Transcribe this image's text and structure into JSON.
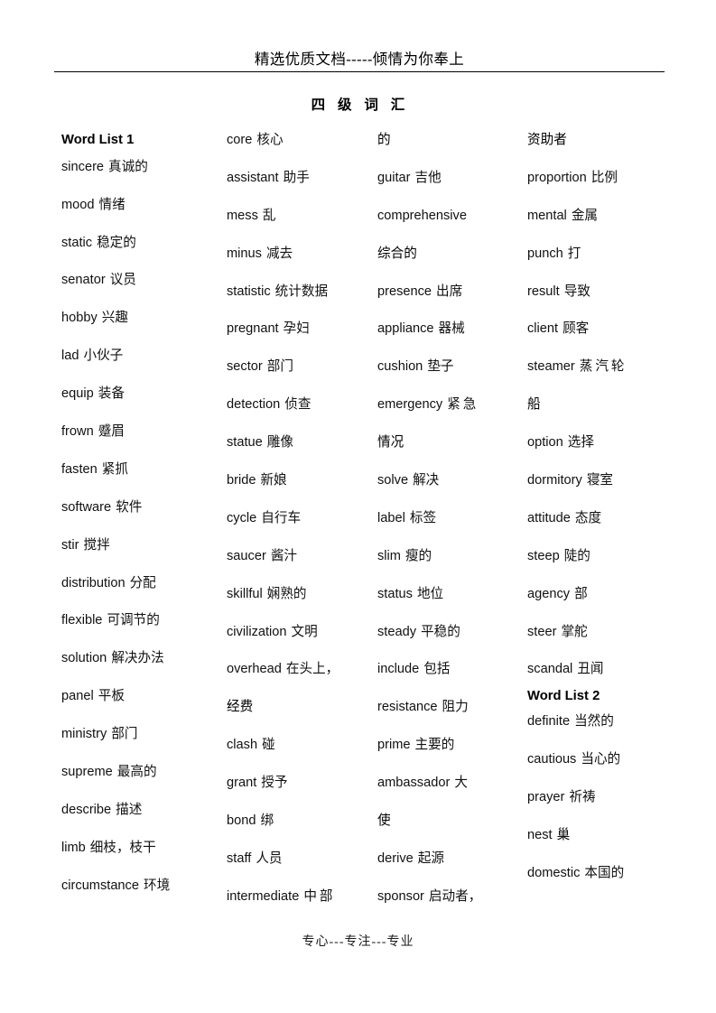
{
  "header": {
    "banner_text": "精选优质文档-----倾情为你奉上"
  },
  "title": "四 级 词 汇",
  "footer": {
    "text": "专心---专注---专业"
  },
  "columns": [
    {
      "id": "column-1",
      "heading": "Word List 1",
      "entries": [
        {
          "word": "sincere",
          "cn": "真诚的"
        },
        {
          "word": "mood",
          "cn": "情绪"
        },
        {
          "word": "static",
          "cn": "稳定的"
        },
        {
          "word": "senator",
          "cn": "议员"
        },
        {
          "word": "hobby",
          "cn": "兴趣"
        },
        {
          "word": "lad",
          "cn": "小伙子"
        },
        {
          "word": "equip",
          "cn": "装备"
        },
        {
          "word": "frown",
          "cn": "蹙眉"
        },
        {
          "word": "fasten",
          "cn": "紧抓"
        },
        {
          "word": "software",
          "cn": "软件"
        },
        {
          "word": "stir",
          "cn": "搅拌"
        },
        {
          "word": "distribution",
          "cn": "分配"
        },
        {
          "word": "flexible",
          "cn": "可调节的"
        },
        {
          "word": "solution",
          "cn": "解决办法"
        },
        {
          "word": "panel",
          "cn": "平板"
        },
        {
          "word": "ministry",
          "cn": "部门"
        },
        {
          "word": "supreme",
          "cn": "最高的"
        },
        {
          "word": "describe",
          "cn": "描述"
        },
        {
          "word": "limb",
          "cn": "细枝，枝干"
        },
        {
          "word": "circumstance",
          "cn": "环境"
        }
      ]
    },
    {
      "id": "column-2",
      "heading": "",
      "entries": [
        {
          "word": "core",
          "cn": "核心"
        },
        {
          "word": "assistant",
          "cn": "助手"
        },
        {
          "word": "mess",
          "cn": "乱"
        },
        {
          "word": "minus",
          "cn": "减去"
        },
        {
          "word": "statistic",
          "cn": "统计数据"
        },
        {
          "word": "pregnant",
          "cn": "孕妇"
        },
        {
          "word": "sector",
          "cn": "部门"
        },
        {
          "word": "detection",
          "cn": "侦查"
        },
        {
          "word": "statue",
          "cn": "雕像"
        },
        {
          "word": "bride",
          "cn": "新娘"
        },
        {
          "word": "cycle",
          "cn": "自行车"
        },
        {
          "word": "saucer",
          "cn": "酱汁"
        },
        {
          "word": "skillful",
          "cn": "娴熟的"
        },
        {
          "word": "civilization",
          "cn": "文明"
        },
        {
          "word": "overhead",
          "cn": "在头上，",
          "cont": "经费"
        },
        {
          "word": "clash",
          "cn": "碰"
        },
        {
          "word": "grant",
          "cn": "授予"
        },
        {
          "word": "bond",
          "cn": "绑"
        },
        {
          "word": "staff",
          "cn": "人员"
        },
        {
          "word": "intermediate",
          "cn": "中部"
        }
      ]
    },
    {
      "id": "column-3",
      "heading": "",
      "carryover": "的",
      "entries": [
        {
          "word": "guitar",
          "cn": "吉他"
        },
        {
          "word": "comprehensive",
          "cn": "",
          "cont": "综合的"
        },
        {
          "word": "presence",
          "cn": "出席"
        },
        {
          "word": "appliance",
          "cn": "器械"
        },
        {
          "word": "cushion",
          "cn": "垫子"
        },
        {
          "word": "emergency",
          "cn": "紧急",
          "cont": "情况"
        },
        {
          "word": "solve",
          "cn": "解决"
        },
        {
          "word": "label",
          "cn": "标签"
        },
        {
          "word": "slim",
          "cn": "瘦的"
        },
        {
          "word": "status",
          "cn": "地位"
        },
        {
          "word": "steady",
          "cn": "平稳的"
        },
        {
          "word": "include",
          "cn": "包括"
        },
        {
          "word": "resistance",
          "cn": "阻力"
        },
        {
          "word": "prime",
          "cn": "主要的"
        },
        {
          "word": "ambassador",
          "cn": "大",
          "cont": "使"
        },
        {
          "word": "derive",
          "cn": "起源"
        },
        {
          "word": "sponsor",
          "cn": "启动者，"
        }
      ]
    },
    {
      "id": "column-4",
      "heading": "",
      "carryover": "资助者",
      "entries": [
        {
          "word": "proportion",
          "cn": "比例"
        },
        {
          "word": "mental",
          "cn": "金属"
        },
        {
          "word": "punch",
          "cn": "打"
        },
        {
          "word": "result",
          "cn": "导致"
        },
        {
          "word": "client",
          "cn": "顾客"
        },
        {
          "word": "steamer",
          "cn": "蒸汽轮",
          "cont": "船"
        },
        {
          "word": "option",
          "cn": "选择"
        },
        {
          "word": "dormitory",
          "cn": "寝室"
        },
        {
          "word": "attitude",
          "cn": "态度"
        },
        {
          "word": "steep",
          "cn": "陡的"
        },
        {
          "word": "agency",
          "cn": "部"
        },
        {
          "word": "steer",
          "cn": "掌舵"
        },
        {
          "word": "scandal",
          "cn": "丑闻"
        }
      ],
      "mid_heading": "Word List 2",
      "entries_after": [
        {
          "word": "definite",
          "cn": "当然的"
        },
        {
          "word": "cautious",
          "cn": "当心的"
        },
        {
          "word": "prayer",
          "cn": "祈祷"
        },
        {
          "word": "nest",
          "cn": "巢"
        },
        {
          "word": "domestic",
          "cn": "本国的"
        }
      ]
    }
  ]
}
